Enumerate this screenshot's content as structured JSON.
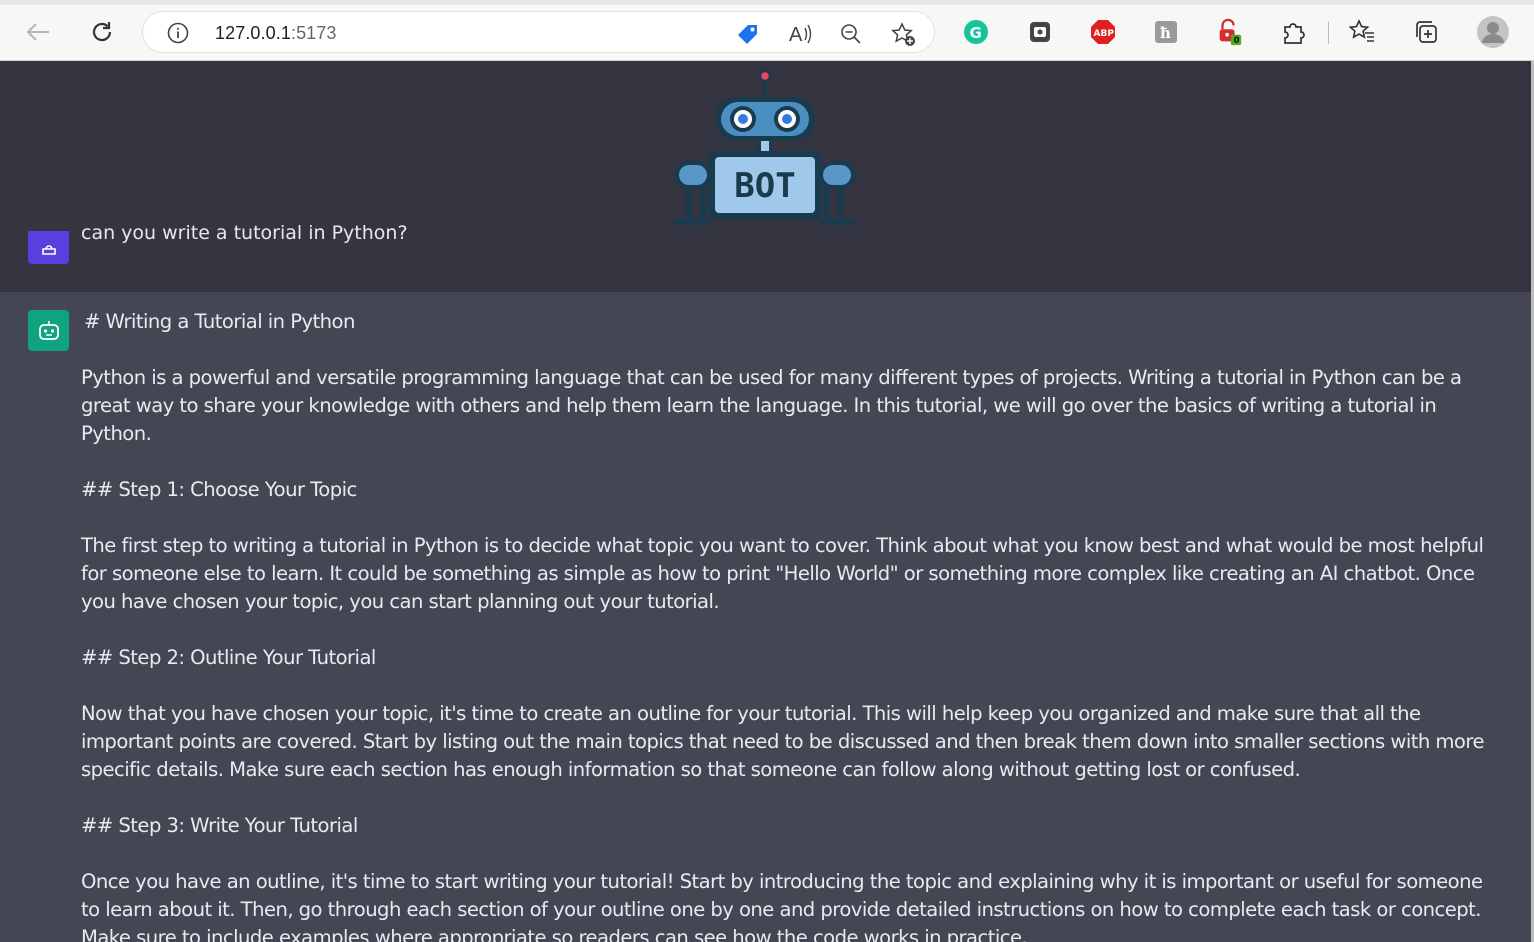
{
  "browser": {
    "url_host": "127.0.0.1",
    "url_port": ":5173",
    "nav": {
      "back": "back-arrow-icon",
      "refresh": "refresh-icon"
    },
    "address_icons": [
      "site-info-icon",
      "tag-icon",
      "read-aloud-icon",
      "zoom-out-icon",
      "add-favorite-icon"
    ],
    "extensions": [
      {
        "name": "grammarly-icon",
        "color": "#15c39a"
      },
      {
        "name": "screen-capture-icon",
        "color": "#333333"
      },
      {
        "name": "adblock-icon",
        "color": "#e01f1f",
        "label": "ABP"
      },
      {
        "name": "hypothesis-icon",
        "color": "#8a8a8a",
        "label": "ħ"
      },
      {
        "name": "lock-extension-icon",
        "color": "#d62d2d",
        "badge": "0"
      },
      {
        "name": "extensions-puzzle-icon",
        "color": "#333333"
      },
      {
        "name": "favorites-icon",
        "color": "#333333"
      },
      {
        "name": "collections-icon",
        "color": "#333333"
      },
      {
        "name": "profile-avatar",
        "color": "#9a9a9a"
      }
    ]
  },
  "header": {
    "logo_text": "BOT"
  },
  "conversation": {
    "user_message": "can you write a tutorial in Python?",
    "bot_message": {
      "paragraphs": [
        "# Writing a Tutorial in Python",
        "Python is a powerful and versatile programming language that can be used for many different types of projects. Writing a tutorial in Python can be a great way to share your knowledge with others and help them learn the language. In this tutorial, we will go over the basics of writing a tutorial in Python.",
        "## Step 1: Choose Your Topic",
        "The first step to writing a tutorial in Python is to decide what topic you want to cover. Think about what you know best and what would be most helpful for someone else to learn. It could be something as simple as how to print \"Hello World\" or something more complex like creating an AI chatbot. Once you have chosen your topic, you can start planning out your tutorial.",
        "## Step 2: Outline Your Tutorial",
        "Now that you have chosen your topic, it's time to create an outline for your tutorial. This will help keep you organized and make sure that all the important points are covered. Start by listing out the main topics that need to be discussed and then break them down into smaller sections with more specific details. Make sure each section has enough information so that someone can follow along without getting lost or confused.",
        "## Step 3: Write Your Tutorial",
        "Once you have an outline, it's time to start writing your tutorial! Start by introducing the topic and explaining why it is important or useful for someone to learn about it. Then, go through each section of your outline one by one and provide detailed instructions on how to complete each task or concept. Make sure to include examples where appropriate so readers can see how the code works in practice."
      ]
    }
  },
  "colors": {
    "background": "#343541",
    "bot_row": "#444654",
    "user_avatar": "#5b3ee0",
    "bot_avatar": "#10a37f",
    "text": "#e9e9ee"
  }
}
